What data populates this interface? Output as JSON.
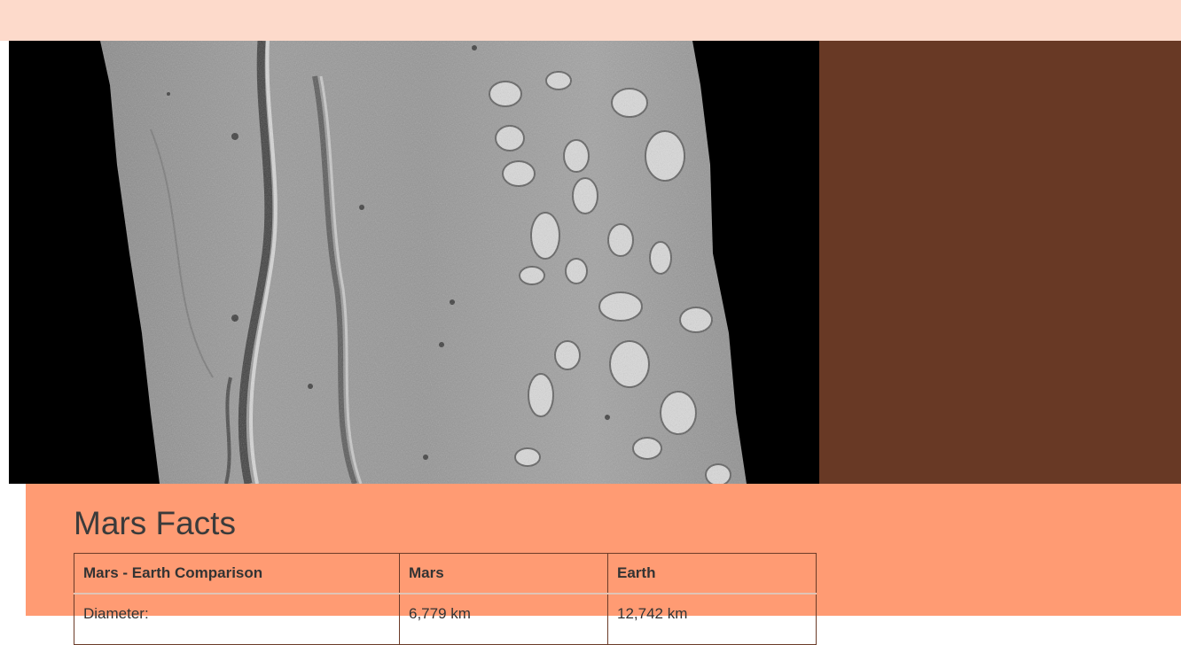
{
  "colors": {
    "top_bar": "#fddacb",
    "image_background": "#000000",
    "side_panel": "#683925",
    "facts_background": "#ff9b73",
    "table_border": "#6b3b28"
  },
  "hero_image": {
    "icon": "mars-surface-image"
  },
  "facts": {
    "title": "Mars Facts",
    "table": {
      "headers": [
        "Mars - Earth Comparison",
        "Mars",
        "Earth"
      ],
      "rows": [
        [
          "Diameter:",
          "6,779 km",
          "12,742 km"
        ]
      ]
    }
  }
}
